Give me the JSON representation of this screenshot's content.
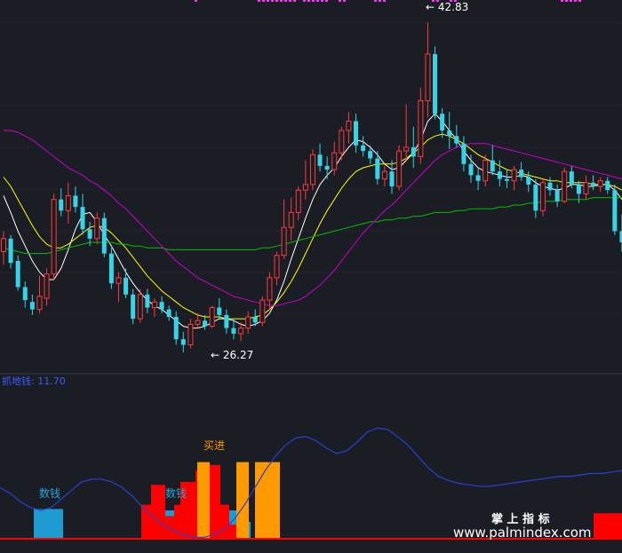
{
  "chart_data": [
    {
      "type": "candlestick",
      "ylim": [
        24,
        44
      ],
      "price_labels": {
        "high": "42.83",
        "low": "26.27"
      },
      "candles": [
        [
          30.5,
          31.6,
          29.8,
          31.2
        ],
        [
          31.2,
          31.4,
          29.6,
          29.9
        ],
        [
          30.0,
          30.3,
          28.4,
          28.6
        ],
        [
          28.6,
          28.9,
          27.5,
          27.9
        ],
        [
          27.8,
          28.2,
          27.1,
          27.4
        ],
        [
          27.4,
          29.2,
          27.2,
          28.1
        ],
        [
          28.0,
          29.6,
          27.6,
          29.3
        ],
        [
          29.3,
          33.6,
          29.0,
          33.3
        ],
        [
          33.3,
          33.9,
          32.4,
          32.7
        ],
        [
          32.7,
          34.2,
          32.0,
          33.5
        ],
        [
          33.5,
          34.0,
          32.6,
          32.9
        ],
        [
          32.9,
          33.6,
          31.4,
          31.7
        ],
        [
          31.7,
          32.1,
          30.8,
          31.2
        ],
        [
          31.2,
          32.6,
          30.9,
          32.3
        ],
        [
          32.3,
          32.6,
          30.2,
          30.4
        ],
        [
          30.4,
          30.7,
          28.5,
          28.8
        ],
        [
          28.8,
          29.4,
          27.8,
          29.1
        ],
        [
          29.1,
          29.6,
          28.0,
          28.2
        ],
        [
          28.2,
          28.5,
          26.6,
          26.9
        ],
        [
          26.9,
          28.5,
          26.7,
          28.2
        ],
        [
          28.2,
          28.5,
          27.2,
          27.5
        ],
        [
          27.5,
          28.0,
          27.0,
          27.8
        ],
        [
          27.8,
          28.1,
          27.2,
          27.4
        ],
        [
          27.4,
          27.6,
          26.8,
          27.0
        ],
        [
          27.0,
          27.3,
          25.5,
          25.8
        ],
        [
          25.8,
          26.2,
          25.1,
          25.5
        ],
        [
          25.5,
          26.9,
          25.3,
          26.6
        ],
        [
          26.6,
          27.2,
          26.4,
          26.8
        ],
        [
          26.8,
          27.1,
          26.3,
          26.5
        ],
        [
          26.5,
          27.6,
          26.4,
          27.5
        ],
        [
          27.5,
          28.0,
          26.9,
          27.1
        ],
        [
          27.1,
          27.4,
          26.1,
          26.4
        ],
        [
          26.4,
          26.9,
          25.8,
          26.1
        ],
        [
          26.1,
          26.7,
          25.7,
          26.4
        ],
        [
          26.4,
          27.3,
          26.1,
          27.0
        ],
        [
          27.0,
          27.4,
          26.5,
          26.7
        ],
        [
          26.7,
          28.1,
          26.5,
          27.9
        ],
        [
          27.9,
          29.4,
          27.4,
          29.1
        ],
        [
          29.1,
          30.5,
          28.7,
          30.3
        ],
        [
          30.3,
          33.3,
          30.1,
          31.8
        ],
        [
          31.8,
          33.4,
          31.1,
          32.6
        ],
        [
          32.6,
          34.0,
          32.2,
          33.8
        ],
        [
          33.8,
          35.4,
          33.3,
          34.1
        ],
        [
          34.1,
          36.0,
          33.8,
          35.7
        ],
        [
          35.7,
          36.3,
          34.8,
          35.1
        ],
        [
          35.1,
          35.6,
          34.4,
          34.9
        ],
        [
          34.9,
          36.4,
          34.6,
          35.8
        ],
        [
          35.8,
          37.2,
          35.4,
          37.0
        ],
        [
          37.0,
          38.0,
          36.3,
          37.5
        ],
        [
          37.5,
          37.9,
          35.8,
          36.2
        ],
        [
          36.2,
          36.7,
          35.6,
          35.9
        ],
        [
          35.9,
          36.2,
          35.2,
          35.5
        ],
        [
          35.5,
          35.9,
          34.1,
          34.4
        ],
        [
          34.4,
          35.1,
          34.0,
          34.8
        ],
        [
          34.8,
          35.4,
          33.6,
          34.0
        ],
        [
          34.0,
          36.2,
          33.8,
          35.9
        ],
        [
          35.9,
          38.4,
          35.4,
          36.1
        ],
        [
          36.1,
          37.2,
          35.0,
          35.6
        ],
        [
          35.6,
          39.3,
          35.2,
          38.6
        ],
        [
          38.6,
          42.8,
          37.7,
          41.1
        ],
        [
          41.1,
          41.5,
          37.6,
          37.9
        ],
        [
          37.9,
          38.2,
          36.6,
          37.0
        ],
        [
          37.0,
          38.0,
          36.0,
          36.7
        ],
        [
          36.7,
          37.3,
          36.1,
          36.3
        ],
        [
          36.3,
          36.7,
          34.8,
          35.2
        ],
        [
          35.2,
          35.7,
          34.2,
          34.6
        ],
        [
          34.6,
          35.0,
          33.8,
          34.3
        ],
        [
          34.3,
          35.7,
          34.0,
          35.4
        ],
        [
          35.4,
          36.2,
          34.6,
          34.8
        ],
        [
          34.8,
          35.4,
          34.0,
          34.4
        ],
        [
          34.4,
          34.9,
          33.9,
          34.3
        ],
        [
          34.3,
          35.1,
          33.8,
          34.9
        ],
        [
          34.9,
          35.3,
          34.3,
          34.5
        ],
        [
          34.5,
          34.8,
          33.7,
          34.1
        ],
        [
          34.1,
          34.4,
          32.3,
          32.7
        ],
        [
          32.7,
          34.4,
          32.4,
          34.2
        ],
        [
          34.2,
          34.5,
          33.5,
          33.8
        ],
        [
          33.8,
          34.1,
          32.9,
          33.2
        ],
        [
          33.2,
          35.0,
          33.1,
          34.8
        ],
        [
          34.8,
          35.1,
          33.9,
          34.1
        ],
        [
          34.1,
          34.3,
          33.1,
          33.6
        ],
        [
          33.6,
          34.6,
          33.3,
          34.2
        ],
        [
          34.2,
          34.6,
          33.8,
          34.0
        ],
        [
          34.0,
          34.5,
          33.7,
          34.3
        ],
        [
          34.3,
          34.5,
          33.6,
          33.8
        ],
        [
          33.8,
          34.1,
          31.4,
          31.6
        ],
        [
          31.6,
          32.5,
          30.5,
          31.0
        ]
      ],
      "series": [
        {
          "name": "",
          "color": "#ffffff",
          "values": [
            33.5,
            32.6,
            31.6,
            30.8,
            30.0,
            29.4,
            29.0,
            29.0,
            29.6,
            30.6,
            31.7,
            32.5,
            32.6,
            32.1,
            31.4,
            30.8,
            30.1,
            29.4,
            28.8,
            28.3,
            27.9,
            27.6,
            27.4,
            27.1,
            26.8,
            26.5,
            26.4,
            26.4,
            26.5,
            26.7,
            26.9,
            26.9,
            26.8,
            26.6,
            26.5,
            26.6,
            26.8,
            27.2,
            27.9,
            28.9,
            30.1,
            31.2,
            32.3,
            33.3,
            34.1,
            34.6,
            35.0,
            35.6,
            36.1,
            36.5,
            36.4,
            36.1,
            35.7,
            35.2,
            34.9,
            35.0,
            35.4,
            35.8,
            36.5,
            37.5,
            37.9,
            37.5,
            37.0,
            36.5,
            35.9,
            35.4,
            35.0,
            34.8,
            34.7,
            34.6,
            34.5,
            34.5,
            34.6,
            34.5,
            34.2,
            34.0,
            33.9,
            33.8,
            33.9,
            34.1,
            34.1,
            34.0,
            34.0,
            34.1,
            34.1,
            33.8,
            33.3
          ]
        },
        {
          "name": "",
          "color": "#ffff00",
          "values": [
            34.5,
            34.0,
            33.3,
            32.6,
            31.9,
            31.3,
            30.9,
            30.7,
            30.7,
            30.9,
            31.2,
            31.5,
            31.8,
            31.9,
            31.8,
            31.5,
            31.1,
            30.7,
            30.2,
            29.7,
            29.2,
            28.8,
            28.4,
            28.1,
            27.8,
            27.5,
            27.3,
            27.1,
            27.0,
            27.0,
            27.0,
            26.9,
            26.9,
            26.9,
            26.9,
            27.0,
            27.1,
            27.4,
            27.8,
            28.3,
            28.9,
            29.6,
            30.4,
            31.2,
            32.0,
            32.7,
            33.3,
            33.9,
            34.4,
            34.8,
            35.0,
            35.1,
            35.2,
            35.2,
            35.2,
            35.3,
            35.5,
            35.8,
            36.1,
            36.5,
            36.7,
            36.8,
            36.7,
            36.5,
            36.3,
            36.0,
            35.7,
            35.5,
            35.3,
            35.1,
            34.9,
            34.8,
            34.7,
            34.6,
            34.5,
            34.4,
            34.3,
            34.3,
            34.2,
            34.2,
            34.2,
            34.2,
            34.1,
            34.1,
            34.1,
            34.0,
            33.8
          ]
        },
        {
          "name": "",
          "color": "#00c000",
          "values": [
            30.7,
            30.6,
            30.5,
            30.4,
            30.4,
            30.4,
            30.4,
            30.5,
            30.6,
            30.7,
            30.8,
            30.9,
            31.0,
            31.0,
            31.0,
            31.0,
            30.9,
            30.9,
            30.8,
            30.8,
            30.7,
            30.7,
            30.7,
            30.6,
            30.6,
            30.6,
            30.6,
            30.6,
            30.6,
            30.6,
            30.6,
            30.6,
            30.6,
            30.6,
            30.6,
            30.6,
            30.7,
            30.7,
            30.8,
            30.9,
            31.0,
            31.1,
            31.2,
            31.3,
            31.4,
            31.5,
            31.6,
            31.7,
            31.8,
            31.9,
            32.0,
            32.1,
            32.1,
            32.2,
            32.2,
            32.3,
            32.3,
            32.4,
            32.4,
            32.5,
            32.6,
            32.6,
            32.6,
            32.7,
            32.7,
            32.8,
            32.8,
            32.8,
            32.8,
            32.9,
            32.9,
            33.0,
            33.0,
            33.1,
            33.1,
            33.2,
            33.2,
            33.2,
            33.3,
            33.3,
            33.3,
            33.3,
            33.4,
            33.4,
            33.4,
            33.4,
            33.4
          ]
        },
        {
          "name": "",
          "color": "#cc00cc",
          "values": [
            37.0,
            37.0,
            36.9,
            36.7,
            36.5,
            36.2,
            35.9,
            35.6,
            35.3,
            35.0,
            34.8,
            34.6,
            34.3,
            34.1,
            33.8,
            33.5,
            33.1,
            32.8,
            32.4,
            32.0,
            31.6,
            31.2,
            30.8,
            30.4,
            30.0,
            29.7,
            29.4,
            29.1,
            28.9,
            28.7,
            28.5,
            28.3,
            28.1,
            28.0,
            27.9,
            27.8,
            27.7,
            27.6,
            27.6,
            27.7,
            27.8,
            27.9,
            28.1,
            28.4,
            28.7,
            29.1,
            29.5,
            30.0,
            30.5,
            31.0,
            31.5,
            31.9,
            32.3,
            32.7,
            33.0,
            33.4,
            33.8,
            34.2,
            34.6,
            35.0,
            35.4,
            35.7,
            35.9,
            36.1,
            36.2,
            36.3,
            36.3,
            36.3,
            36.2,
            36.1,
            36.0,
            35.9,
            35.8,
            35.7,
            35.6,
            35.5,
            35.4,
            35.3,
            35.2,
            35.1,
            35.0,
            34.9,
            34.8,
            34.7,
            34.6,
            34.5,
            34.4
          ]
        }
      ]
    },
    {
      "type": "bar",
      "title": "抓地钱: 11.70",
      "annotations": [
        {
          "text": "数钱",
          "color": "#29a3d6"
        },
        {
          "text": "数钱",
          "color": "#29a3d6"
        },
        {
          "text": "买进",
          "color": "#ff9900"
        }
      ],
      "bars": [
        {
          "from": 18,
          "to": 27,
          "value": 1.0,
          "color": "#1e9bd0"
        },
        {
          "from": 79,
          "to": 89,
          "value": 1.7,
          "color": "#ff0000"
        },
        {
          "from": 89,
          "to": 96,
          "value": 1.5,
          "color": "#ff0000"
        },
        {
          "from": 96,
          "to": 101,
          "value": 1.2,
          "color": "#ff0000"
        },
        {
          "from": 101,
          "to": 107,
          "value": 1.9,
          "color": "#ff0000"
        },
        {
          "from": 107,
          "to": 113,
          "value": 2.4,
          "color": "#ff0000"
        },
        {
          "from": 113,
          "to": 118,
          "value": 2.7,
          "color": "#ff0000"
        },
        {
          "from": 118,
          "to": 125,
          "value": 2.0,
          "color": "#ff0000"
        },
        {
          "from": 125,
          "to": 130,
          "value": 1.2,
          "color": "#ff0000"
        },
        {
          "from": 132,
          "to": 136,
          "value": 2.7,
          "color": "#ff9900"
        },
        {
          "from": 136,
          "to": 141,
          "value": 0.5,
          "color": "#ff0000"
        },
        {
          "from": 141,
          "to": 145,
          "value": 0.8,
          "color": "#ff0000"
        },
        {
          "from": 145,
          "to": 149,
          "value": 2.7,
          "color": "#ff9900"
        },
        {
          "from": 149,
          "to": 160,
          "value": 2.7,
          "color": "#ff9900"
        },
        {
          "from": 668,
          "to": 700,
          "value": 0.9,
          "color": "#ff0000"
        }
      ],
      "cyan_bars": [
        {
          "from": 186,
          "to": 196,
          "value": 1.0
        },
        {
          "from": 198,
          "to": 203,
          "value": 1.0
        },
        {
          "from": 252,
          "to": 268,
          "value": 1.0
        },
        {
          "from": 276,
          "to": 282,
          "value": 0.6
        }
      ],
      "orange_bars": [
        {
          "from": 222,
          "to": 236,
          "value": 2.7
        },
        {
          "from": 266,
          "to": 280,
          "value": 2.7
        },
        {
          "from": 287,
          "to": 315,
          "value": 2.7
        }
      ],
      "red_bars": [
        {
          "from": 159,
          "to": 170,
          "value": 1.2
        },
        {
          "from": 170,
          "to": 186,
          "value": 1.9
        },
        {
          "from": 186,
          "to": 196,
          "value": 0.8
        },
        {
          "from": 196,
          "to": 203,
          "value": 1.2
        },
        {
          "from": 203,
          "to": 220,
          "value": 2.0
        },
        {
          "from": 220,
          "to": 232,
          "value": 2.4
        },
        {
          "from": 232,
          "to": 248,
          "value": 2.6
        },
        {
          "from": 248,
          "to": 258,
          "value": 1.2
        },
        {
          "from": 258,
          "to": 266,
          "value": 0.5
        },
        {
          "from": 668,
          "to": 700,
          "value": 0.9
        }
      ],
      "blue_line": [
        1.8,
        1.6,
        1.3,
        1.1,
        1.0,
        1.1,
        1.4,
        1.7,
        2.0,
        2.1,
        2.1,
        2.0,
        1.8,
        1.5,
        1.1,
        0.8,
        0.5,
        0.3,
        0.15,
        0.05,
        0.05,
        0.15,
        0.35,
        0.7,
        1.2,
        1.8,
        2.4,
        2.9,
        3.3,
        3.55,
        3.6,
        3.45,
        3.2,
        3.0,
        3.1,
        3.4,
        3.75,
        3.9,
        3.85,
        3.6,
        3.3,
        2.9,
        2.5,
        2.2,
        2.05,
        1.95,
        1.9,
        1.85,
        1.85,
        1.9,
        1.95,
        2.0,
        2.05,
        2.1,
        2.15,
        2.2,
        2.2,
        2.25,
        2.3,
        2.3,
        2.35,
        2.4
      ],
      "brand_title": "掌 上 指 标",
      "brand_url": "www.palmindex.com"
    }
  ]
}
